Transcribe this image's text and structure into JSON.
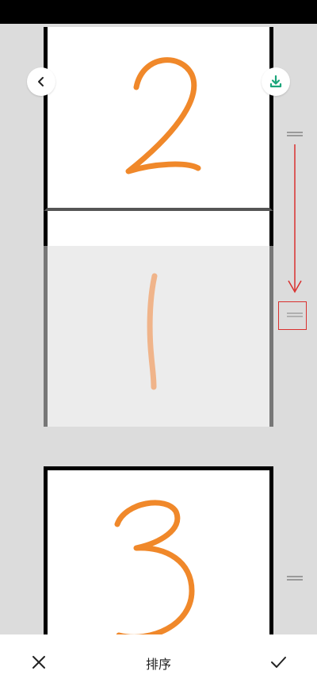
{
  "toolbar": {
    "back_icon": "chevron-left-icon",
    "download_icon": "download-icon",
    "download_color": "#1aa57a"
  },
  "pages": [
    {
      "digit": "2",
      "stroke_color": "#f0882a",
      "state": "normal"
    },
    {
      "digit": "1",
      "stroke_color": "#f0b48a",
      "state": "dragging"
    },
    {
      "digit": "3",
      "stroke_color": "#f0882a",
      "state": "normal"
    }
  ],
  "drag_hint": {
    "arrow_color": "#d9302e",
    "box_color": "#d9302e"
  },
  "bottom_bar": {
    "title": "排序",
    "close_icon": "close-icon",
    "confirm_icon": "check-icon"
  }
}
